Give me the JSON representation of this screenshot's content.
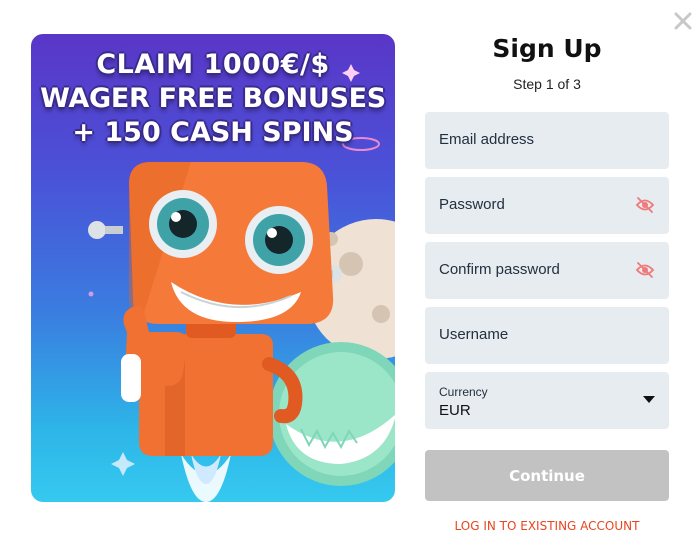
{
  "colors": {
    "accent": "#e8461e",
    "field_bg": "#e6ecef",
    "button_disabled": "#c2c2c2",
    "eye_icon": "#f07a7a"
  },
  "promo": {
    "headline_line1": "CLAIM  1000€/$",
    "headline_line2": "WAGER FREE BONUSES",
    "headline_line3": "+ 150 CASH SPINS"
  },
  "form": {
    "title": "Sign Up",
    "step": "Step 1 of 3",
    "email_placeholder": "Email address",
    "password_placeholder": "Password",
    "confirm_placeholder": "Confirm password",
    "username_placeholder": "Username",
    "currency_label": "Currency",
    "currency_value": "EUR",
    "continue_label": "Continue",
    "login_link": "LOG IN TO EXISTING ACCOUNT"
  },
  "icons": {
    "close": "close-icon",
    "eye": "eye-off-icon",
    "caret": "caret-down-icon"
  }
}
